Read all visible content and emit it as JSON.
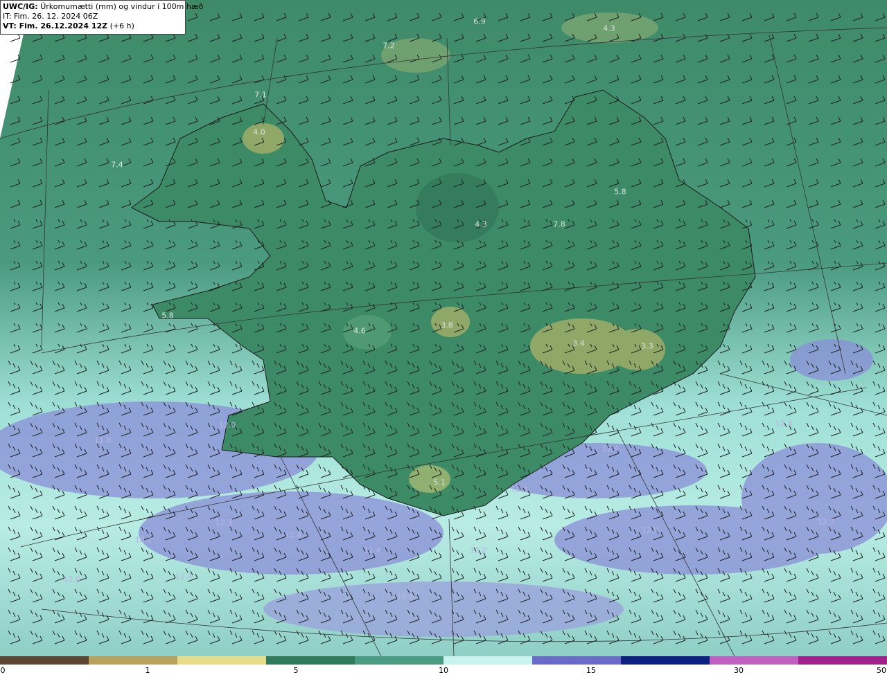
{
  "header": {
    "model": "UWC/IG:",
    "title": "Úrkomumætti (mm) og vindur í 100m hæð",
    "it": "IT: Fim. 26. 12. 2024 06Z",
    "vt_label": "VT: Fim. 26.12.2024 12Z",
    "vt_offset": "(+6 h)"
  },
  "colorbar": {
    "ticks": [
      "0",
      "1",
      "5",
      "10",
      "15",
      "30",
      "50"
    ],
    "colors": [
      "#5a4630",
      "#b8a260",
      "#e6dc8a",
      "#2f7a5a",
      "#4a9a84",
      "#c8f4f0",
      "#6a6ac8",
      "#102080",
      "#c060c0",
      "#a0208c"
    ]
  },
  "labels": [
    {
      "text": "6.9",
      "kind": "land"
    },
    {
      "text": "4.3",
      "kind": "land"
    },
    {
      "text": "7.2",
      "kind": "land"
    },
    {
      "text": "7.1",
      "kind": "land"
    },
    {
      "text": "4.0",
      "kind": "land"
    },
    {
      "text": "7.4",
      "kind": "land"
    },
    {
      "text": "5.8",
      "kind": "land"
    },
    {
      "text": "4.3",
      "kind": "land"
    },
    {
      "text": "7.8",
      "kind": "land"
    },
    {
      "text": "5.8",
      "kind": "land"
    },
    {
      "text": "4.6",
      "kind": "land"
    },
    {
      "text": "3.8",
      "kind": "land"
    },
    {
      "text": "3.4",
      "kind": "land"
    },
    {
      "text": "3.3",
      "kind": "land"
    },
    {
      "text": "11.8",
      "kind": "sea"
    },
    {
      "text": "12.0",
      "kind": "sea"
    },
    {
      "text": "12.4",
      "kind": "sea"
    },
    {
      "text": "12.4",
      "kind": "sea"
    },
    {
      "text": "5.1",
      "kind": "land"
    },
    {
      "text": "12.3",
      "kind": "sea"
    },
    {
      "text": "12.3",
      "kind": "sea"
    },
    {
      "text": "12.4",
      "kind": "sea"
    },
    {
      "text": "12.4",
      "kind": "sea"
    },
    {
      "text": "10.2",
      "kind": "sea"
    },
    {
      "text": "12.2",
      "kind": "sea"
    },
    {
      "text": "12.9",
      "kind": "sea"
    },
    {
      "text": "12.7",
      "kind": "sea"
    },
    {
      "text": "12.0",
      "kind": "sea"
    },
    {
      "text": "12.4",
      "kind": "sea"
    },
    {
      "text": "10.6",
      "kind": "sea"
    }
  ]
}
